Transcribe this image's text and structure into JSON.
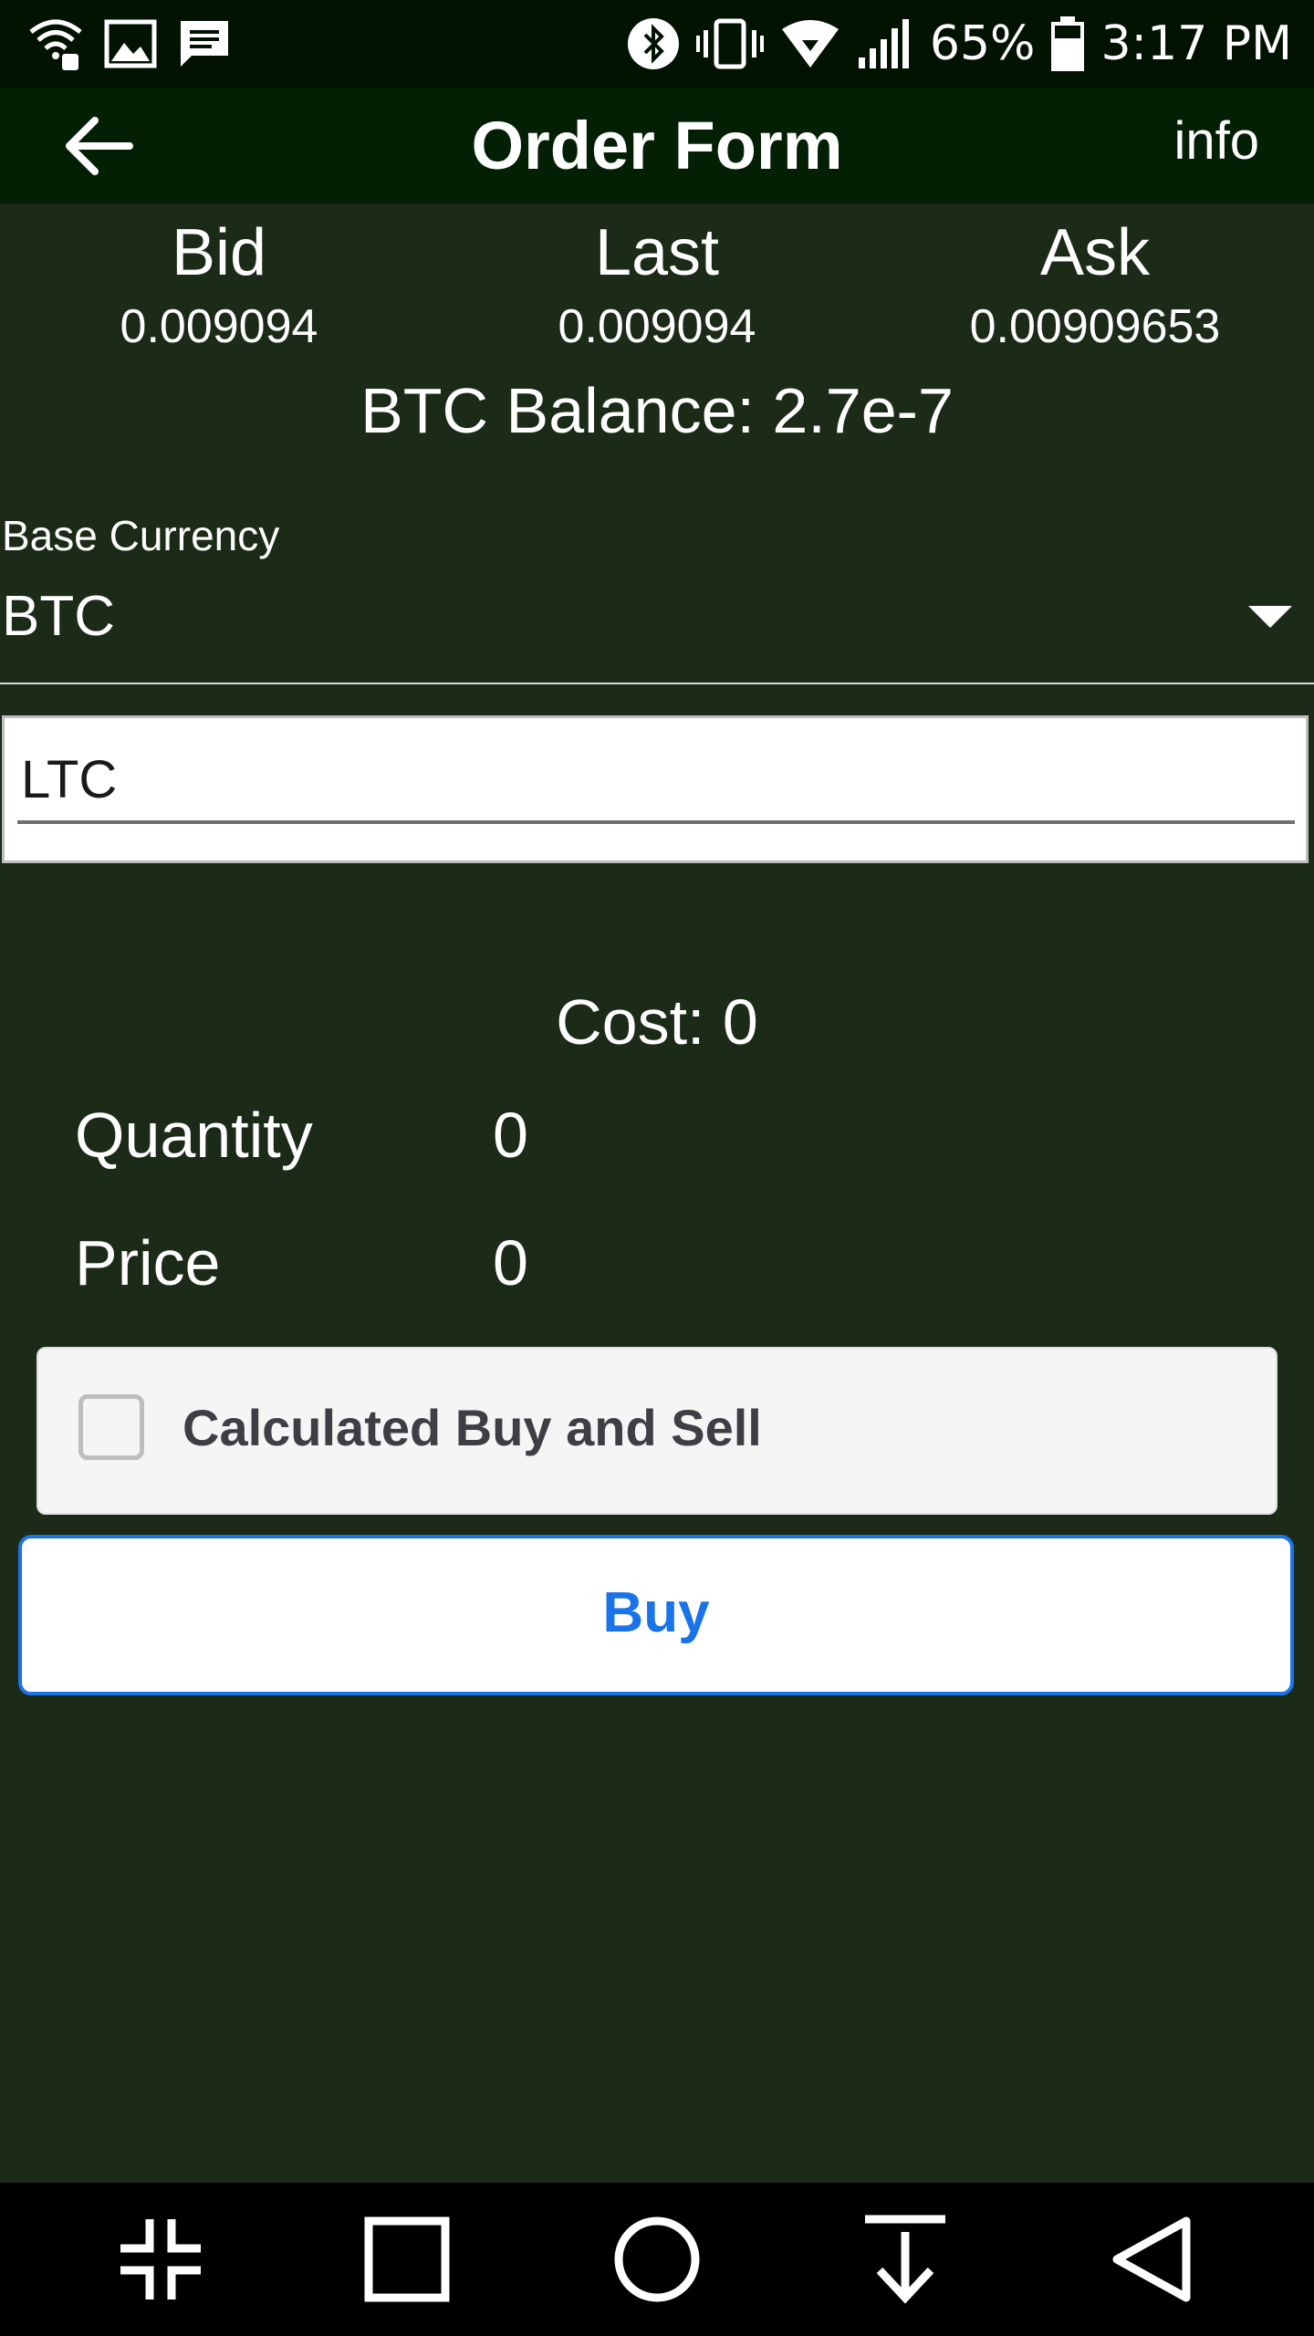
{
  "status_bar": {
    "battery_percent": "65%",
    "time": "3:17 PM",
    "icons": [
      "wifi-call-icon",
      "image-icon",
      "message-icon",
      "bluetooth-icon",
      "vibrate-icon",
      "wifi-icon",
      "signal-icon",
      "battery-icon"
    ]
  },
  "app_bar": {
    "title": "Order Form",
    "info_label": "info",
    "back_icon": "arrow-left-icon"
  },
  "prices": {
    "bid_label": "Bid",
    "bid_value": "0.009094",
    "last_label": "Last",
    "last_value": "0.009094",
    "ask_label": "Ask",
    "ask_value": "0.00909653"
  },
  "balance": {
    "text": "BTC Balance: 2.7e-7"
  },
  "base_currency": {
    "label": "Base Currency",
    "selected": "BTC"
  },
  "coin_field": {
    "value": "LTC"
  },
  "order": {
    "cost_text": "Cost: 0",
    "quantity_label": "Quantity",
    "quantity_value": "0",
    "price_label": "Price",
    "price_value": "0"
  },
  "calculated": {
    "label": "Calculated Buy and Sell",
    "checked": false
  },
  "buy_button": {
    "label": "Buy"
  },
  "nav_bar": {
    "icons": [
      "compress-icon",
      "recent-apps-icon",
      "home-icon",
      "notification-pull-icon",
      "back-icon"
    ]
  },
  "colors": {
    "background": "#1b2b17",
    "app_bar": "#042004",
    "status_bar": "#021302",
    "accent": "#1a73e8"
  }
}
